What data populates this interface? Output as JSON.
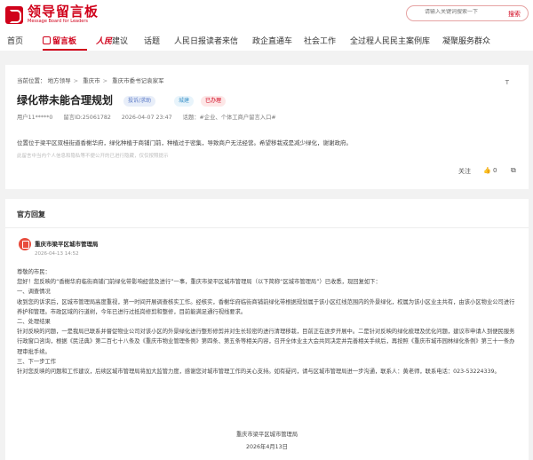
{
  "header": {
    "logo_cn": "领导留言板",
    "logo_en": "Message Board for Leaders",
    "search_placeholder": "请输入关键词搜索一下",
    "search_button": "搜索"
  },
  "nav": {
    "items": [
      "首页",
      "留言板",
      "建议",
      "话题",
      "人民日报读者来信",
      "政企直通车",
      "社会工作",
      "全过程人民民主案例库",
      "凝聚服务群众"
    ],
    "brand_prefix": "人民"
  },
  "message": {
    "breadcrumb_label": "当前位置：",
    "breadcrumb": [
      "地方领导",
      "重庆市",
      "重庆市委书记袁家军"
    ],
    "font_toggle": "T",
    "title": "绿化带未能合理规划",
    "tag_type": "投诉/求助",
    "tag_category": "城建",
    "tag_status": "已办理",
    "user": "用户11*****0",
    "id": "留言ID:25061782",
    "time": "2026-04-07 23:47",
    "labels": "话题：#企业、个体工商户留言入口#",
    "content": "位置位于梁平区双桂街道香榭华府，绿化种植于商铺门前，种植过于密集，导致商户无法经营。希望移栽或是减少绿化，谢谢政府。",
    "hint": "此留言中当内个人信息和隐私等不便公开的已进行隐藏，仅仅按照提示",
    "follow": "关注",
    "like_count": "0"
  },
  "reply": {
    "heading": "官方回复",
    "org": "重庆市梁平区城市管理局",
    "time": "2026-04-13 14:52",
    "paragraphs": [
      "尊敬的市民：",
      "您好！您反映的“香榭华府临街商铺门前绿化带影响经营及进行”一事，重庆市梁平区城市管理局（以下简称“区城市管理局”）已收悉，现回复如下：",
      "一、调查情况",
      "收到您的诉求后，区城市管理局高度重视，第一时间开展调查核实工作。经核实，香榭华府临街商铺前绿化带根据规划属于该小区红线范围内的外景绿化，权属为该小区业主共有，由该小区物业公司进行养护和管理。市政区域的行道树，今年已进行过抵岗修剪和整修，目前能满足通行视线要求。",
      "二、处理结果",
      "针对反映的问题，一是我局已联系并督促物业公司对该小区的外景绿化进行整形修剪并对生长较密的进行清理移栽，目前正在逐步开展中。二是针对反映的绿化梳理及优化问题，建议市申请人到便民服务行政窗口咨询，根据《民法典》第二百七十八条及《重庆市物业管理条例》第四条、第五条等相关内容，召开全体业主大会共同决定并完善相关手续后，再按照《重庆市城市园林绿化条例》第三十一条办理审批手续。",
      "三、下一步工作",
      "针对您反映的问题和工作建议，后续区城市管理局将加大监管力度，感谢您对城市管理工作的关心支持。如有疑问，请与区城市管理局进一步沟通，联系人：黄老师，联系电话：023-53224339。"
    ],
    "sign_org": "重庆市梁平区城市管理局",
    "sign_date": "2026年4月13日"
  },
  "colors": {
    "brand": "#d0021b"
  }
}
